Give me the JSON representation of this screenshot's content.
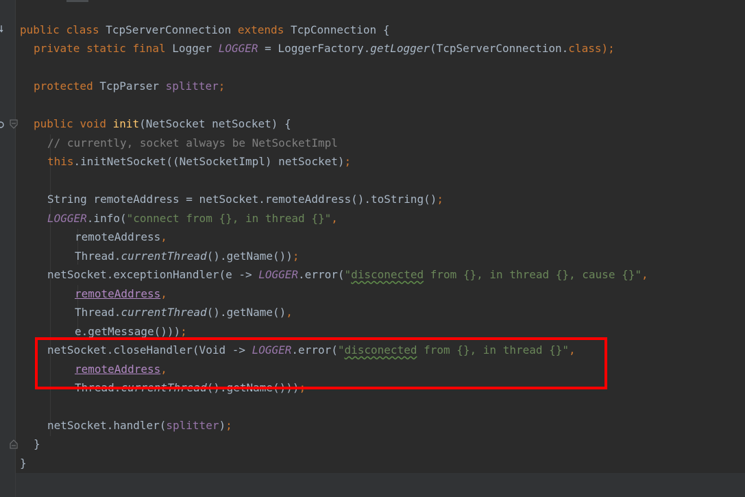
{
  "editor": {
    "code": {
      "l1": [
        "public ",
        "class ",
        "TcpServerConnection ",
        "extends ",
        "TcpConnection {"
      ],
      "l2": [
        "private ",
        "static ",
        "final ",
        "Logger ",
        "LOGGER",
        " = LoggerFactory.",
        "getLogger",
        "(TcpServerConnection.",
        "class",
        ");"
      ],
      "l4": [
        "protected ",
        "TcpParser ",
        "splitter",
        ";"
      ],
      "l6": [
        "public ",
        "void ",
        "init",
        "(NetSocket netSocket) {"
      ],
      "l7": [
        "// currently, socket always be NetSocketImpl"
      ],
      "l8": [
        "this",
        ".initNetSocket((NetSocketImpl) netSocket)",
        ";"
      ],
      "l10": [
        "String remoteAddress = netSocket.remoteAddress().toString()",
        ";"
      ],
      "l11": [
        "LOGGER",
        ".info(",
        "\"connect from {}, in thread {}\"",
        ","
      ],
      "l12": [
        "remoteAddress",
        ","
      ],
      "l13": [
        "Thread.",
        "currentThread",
        "().getName())",
        ";"
      ],
      "l14": [
        "netSocket.exceptionHandler(e -> ",
        "LOGGER",
        ".error(",
        "\"",
        "disconected",
        " from {}, in thread {}, cause {}\"",
        ","
      ],
      "l15": [
        "remoteAddress",
        ","
      ],
      "l16": [
        "Thread.",
        "currentThread",
        "().getName()",
        ","
      ],
      "l17": [
        "e.getMessage()))",
        ";"
      ],
      "l18": [
        "netSocket.closeHandler(Void -> ",
        "LOGGER",
        ".error(",
        "\"",
        "disconected",
        " from {}, in thread {}\"",
        ","
      ],
      "l19": [
        "remoteAddress",
        ","
      ],
      "l20": [
        "Thread.",
        "currentThread",
        "().getName()))",
        ";"
      ],
      "l22": [
        "netSocket.handler(",
        "splitter",
        ")",
        ";"
      ],
      "l23": [
        "}"
      ],
      "l24": [
        "}"
      ]
    }
  },
  "colors": {
    "background": "#2b2b2b",
    "gutter": "#313335",
    "keyword": "#cc7832",
    "field": "#9876aa",
    "method_decl": "#ffc66d",
    "string": "#6a8759",
    "comment": "#808080",
    "default_text": "#a9b7c6",
    "highlight_box": "#ff0000"
  },
  "icons": {
    "gutter": [
      "bookmark-arrow-icon",
      "override-marker-icon",
      "fold-open-icon",
      "fold-close-icon"
    ]
  }
}
